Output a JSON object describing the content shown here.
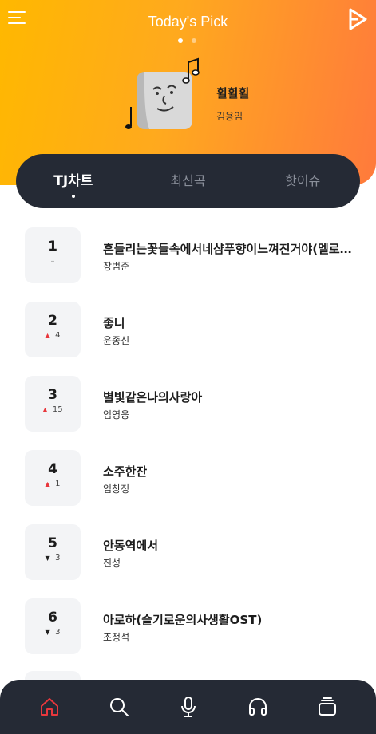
{
  "header": {
    "title": "Today's Pick",
    "page_dots": 2,
    "active_dot": 0
  },
  "pick": {
    "title": "휠휠휠",
    "artist": "김용임"
  },
  "tabs": [
    {
      "label": "TJ차트",
      "active": true
    },
    {
      "label": "최신곡",
      "active": false
    },
    {
      "label": "핫이슈",
      "active": false
    }
  ],
  "chart": [
    {
      "rank": "1",
      "change": "–",
      "dir": "same",
      "title": "흔들리는꽃들속에서네샴푸향이느껴진거야(멜로…",
      "artist": "장범준"
    },
    {
      "rank": "2",
      "change": "4",
      "dir": "up",
      "title": "좋니",
      "artist": "윤종신"
    },
    {
      "rank": "3",
      "change": "15",
      "dir": "up",
      "title": "별빛같은나의사랑아",
      "artist": "임영웅"
    },
    {
      "rank": "4",
      "change": "1",
      "dir": "up",
      "title": "소주한잔",
      "artist": "임창정"
    },
    {
      "rank": "5",
      "change": "3",
      "dir": "down",
      "title": "안동역에서",
      "artist": "진성"
    },
    {
      "rank": "6",
      "change": "3",
      "dir": "down",
      "title": "아로하(슬기로운의사생활OST)",
      "artist": "조정석"
    }
  ],
  "bottom_nav": [
    {
      "icon": "home-icon",
      "active": true
    },
    {
      "icon": "search-icon",
      "active": false
    },
    {
      "icon": "microphone-icon",
      "active": false
    },
    {
      "icon": "headphones-icon",
      "active": false
    },
    {
      "icon": "library-icon",
      "active": false
    }
  ],
  "colors": {
    "accent": "#e8373d",
    "hero_start": "#ffb800",
    "hero_end": "#ff7a3c",
    "dark": "#252a35"
  }
}
